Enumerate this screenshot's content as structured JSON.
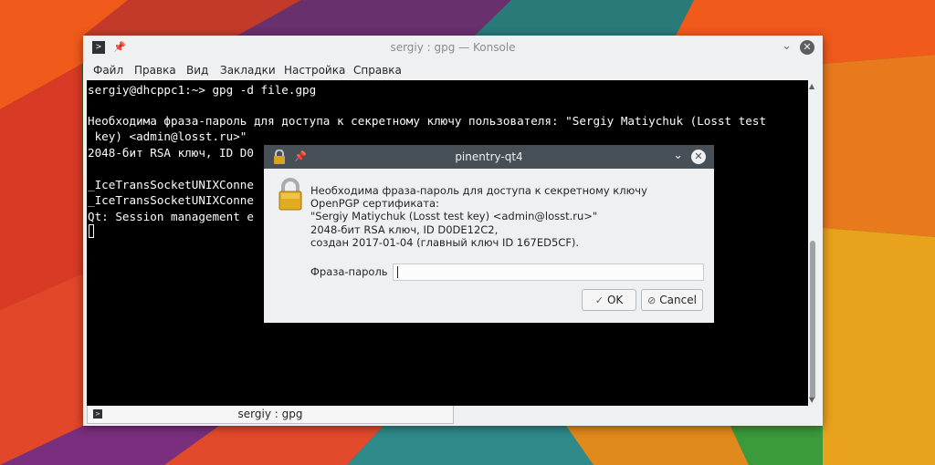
{
  "konsole": {
    "title": "sergiy : gpg — Konsole",
    "app_icon": ">",
    "menu": [
      "Файл",
      "Правка",
      "Вид",
      "Закладки",
      "Настройка",
      "Справка"
    ],
    "terminal_lines": [
      "sergiy@dhcppc1:~> gpg -d file.gpg",
      "",
      "Необходима фраза-пароль для доступа к секретному ключу пользователя: \"Sergiy Matiychuk (Losst test",
      " key) <admin@losst.ru>\"",
      "2048-бит RSA ключ, ID D0",
      "",
      "_IceTransSocketUNIXConne",
      "_IceTransSocketUNIXConne",
      "Qt: Session management e"
    ],
    "tab_label": "sergiy : gpg",
    "tab_icon": ">"
  },
  "dialog": {
    "title": "pinentry-qt4",
    "description_lines": [
      "Необходима фраза-пароль для доступа к секретному ключу",
      "OpenPGP сертификата:",
      "\"Sergiy Matiychuk (Losst test key) <admin@losst.ru>\"",
      "2048-бит RSA ключ, ID D0DE12C2,",
      "создан 2017-01-04 (главный ключ ID 167ED5CF)."
    ],
    "passphrase_label": "Фраза-пароль",
    "passphrase_value": "",
    "ok_label": "OK",
    "cancel_label": "Cancel"
  },
  "icons": {
    "pin": "pin-icon",
    "minimize": "chevron-down-icon",
    "close": "close-icon",
    "lock": "lock-icon",
    "check": "check-icon",
    "cancel": "cancel-icon"
  },
  "colors": {
    "dialog_titlebar": "#475057",
    "terminal_bg": "#000000",
    "terminal_fg": "#fcfcfc",
    "window_bg": "#eff0f1",
    "lock_gold": "#d9a520"
  }
}
